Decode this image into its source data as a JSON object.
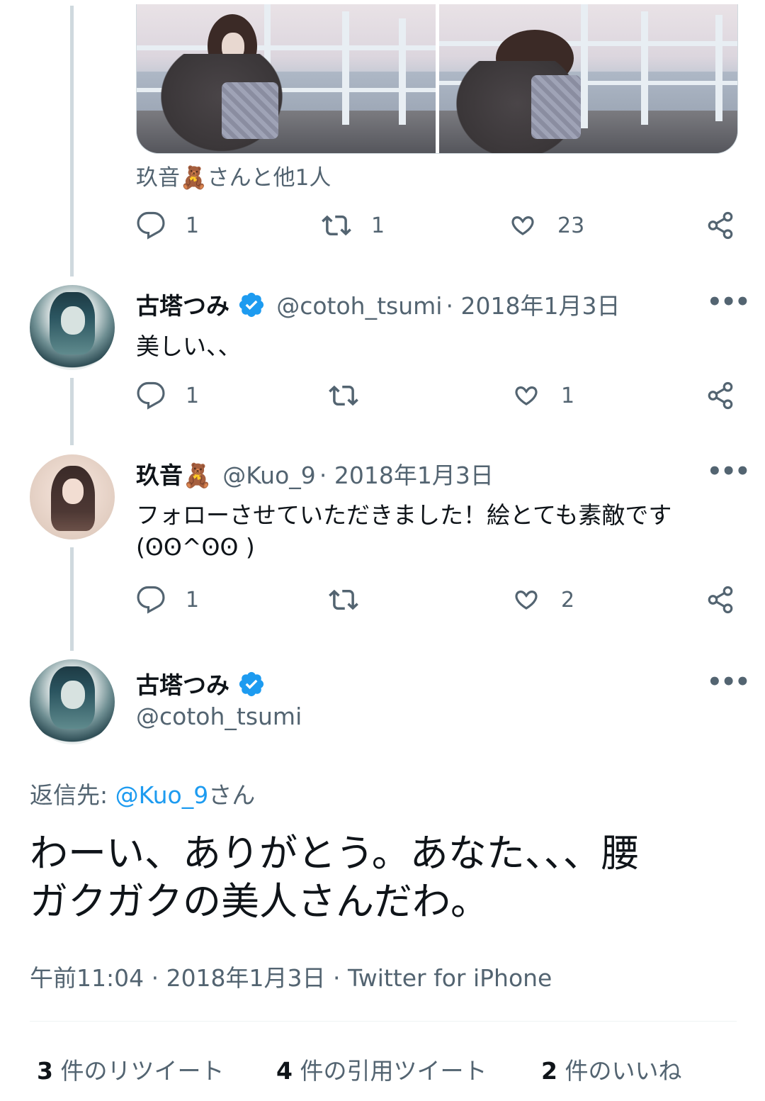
{
  "tweet0": {
    "liked_by": "玖音🧸さんと他1人",
    "actions": {
      "reply": "1",
      "retweet": "1",
      "like": "23"
    }
  },
  "reply1": {
    "name": "古塔つみ",
    "handle": "@cotoh_tsumi",
    "date": "· 2018年1月3日",
    "text": "美しい、、",
    "actions": {
      "reply": "1",
      "retweet": "",
      "like": "1"
    }
  },
  "reply2": {
    "name": "玖音🧸",
    "handle": "@Kuo_9",
    "date": "· 2018年1月3日",
    "text_line1": "フォローさせていただきました！絵とても素敵です",
    "text_line2": "(ꙨꙨ^ꙨꙨ )",
    "actions": {
      "reply": "1",
      "retweet": "",
      "like": "2"
    }
  },
  "main": {
    "name": "古塔つみ",
    "handle": "@cotoh_tsumi",
    "reply_to_label": "返信先:",
    "reply_to_handle": "@Kuo_9",
    "reply_to_suffix": "さん",
    "text_line1": "わーい、ありがとう。あなた、、、腰",
    "text_line2": "ガクガクの美人さんだわ。",
    "timestamp": "午前11:04 · 2018年1月3日 · Twitter for iPhone",
    "stats": {
      "retweets_num": "3",
      "retweets_label": "件のリツイート",
      "quotes_num": "4",
      "quotes_label": "件の引用ツイート",
      "likes_num": "2",
      "likes_label": "件のいいね"
    }
  },
  "colors": {
    "accent": "#1d9bf0",
    "secondary_text": "#536471",
    "thread_line": "#cfd9de"
  },
  "icons": [
    "reply-icon",
    "retweet-icon",
    "like-icon",
    "share-icon",
    "verified-badge-icon",
    "more-icon"
  ]
}
